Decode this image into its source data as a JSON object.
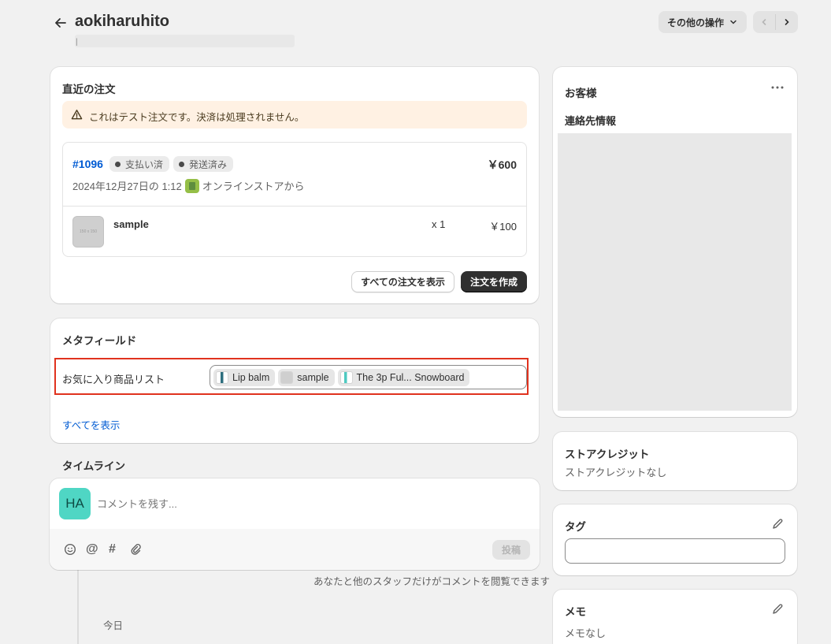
{
  "header": {
    "title": "aokiharuhito",
    "more_actions": "その他の操作",
    "subtitle_placeholder": "|"
  },
  "orders": {
    "heading": "直近の注文",
    "test_banner": "これはテスト注文です。決済は処理されません。",
    "order_number": "#1096",
    "payment_status": "支払い済",
    "fulfillment_status": "発送済み",
    "total": "￥600",
    "date_text": "2024年12月27日の 1:12",
    "channel": "オンラインストアから",
    "item": {
      "thumb_text": "150 x 150",
      "name": "sample",
      "quantity": "x 1",
      "price": "￥100"
    },
    "view_all_button": "すべての注文を表示",
    "create_button": "注文を作成"
  },
  "metafields": {
    "heading": "メタフィールド",
    "field_label": "お気に入り商品リスト",
    "chips": [
      "Lip balm",
      "sample",
      "The 3p Ful... Snowboard"
    ],
    "view_all_link": "すべてを表示"
  },
  "timeline": {
    "heading": "タイムライン",
    "avatar_initials": "HA",
    "avatar_color": "#4fd6c4",
    "comment_placeholder": "コメントを残す...",
    "post_button": "投稿",
    "visibility_note": "あなたと他のスタッフだけがコメントを閲覧できます",
    "today_label": "今日"
  },
  "customer": {
    "heading": "お客様",
    "contact_heading": "連絡先情報"
  },
  "store_credit": {
    "heading": "ストアクレジット",
    "value": "ストアクレジットなし"
  },
  "tags": {
    "heading": "タグ",
    "input_value": ""
  },
  "notes": {
    "heading": "メモ",
    "value": "メモなし"
  },
  "colors": {
    "highlight_border": "#e0321e",
    "link": "#005bd3",
    "banner_bg": "#fff1e3"
  }
}
